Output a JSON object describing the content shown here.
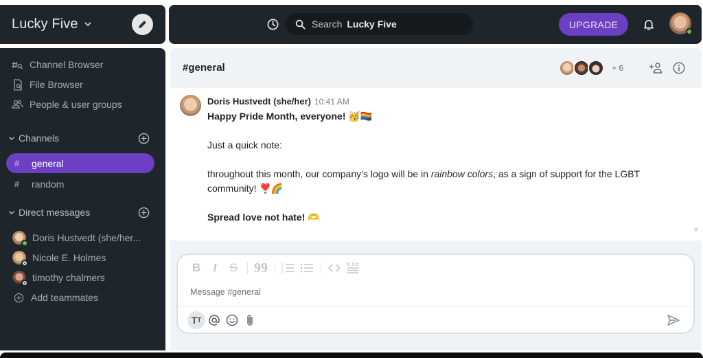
{
  "workspace": {
    "name": "Lucky Five",
    "compose_icon": "pencil-icon"
  },
  "topbar": {
    "history_icon": "clock-icon",
    "search_placeholder": "Search",
    "search_scope": "Lucky Five",
    "upgrade_label": "UPGRADE",
    "notifications_icon": "bell-icon",
    "user_status": "online"
  },
  "sidebar": {
    "nav": [
      {
        "label": "Channel Browser",
        "icon": "channel-search-icon"
      },
      {
        "label": "File Browser",
        "icon": "file-search-icon"
      },
      {
        "label": "People & user groups",
        "icon": "people-icon"
      }
    ],
    "channels_label": "Channels",
    "channels": [
      {
        "name": "general",
        "active": true
      },
      {
        "name": "random",
        "active": false
      }
    ],
    "dms_label": "Direct messages",
    "dms": [
      {
        "name": "Doris Hustvedt (she/her...",
        "status": "online"
      },
      {
        "name": "Nicole E. Holmes",
        "status": "offline"
      },
      {
        "name": "timothy chalmers",
        "status": "offline"
      }
    ],
    "add_teammates": "Add teammates"
  },
  "channel": {
    "title": "#general",
    "members_extra": "+ 6",
    "member_avatar_count": 3
  },
  "message": {
    "author": "Doris Hustvedt (she/her)",
    "time": "10:41 AM",
    "line1": "Happy Pride Month, everyone! 🥳🏳️‍🌈",
    "line2": "Just a quick note:",
    "line3_pre": "throughout this month, our company’s logo will be in ",
    "line3_em": "rainbow colors",
    "line3_post": ", as a sign of support for the LGBT",
    "line4": "community! ❣️🌈",
    "line5": "Spread love not hate! 🫶"
  },
  "composer": {
    "placeholder": "Message #general",
    "format_buttons": [
      "bold",
      "italic",
      "strikethrough",
      "quote",
      "ordered-list",
      "bullet-list",
      "code",
      "code-block"
    ],
    "tools": [
      "text-format",
      "mention",
      "emoji",
      "attach"
    ],
    "send_icon": "send-icon"
  },
  "colors": {
    "accent": "#6c3fc3",
    "dark_panel": "#1f262b",
    "online": "#6cc04a"
  }
}
